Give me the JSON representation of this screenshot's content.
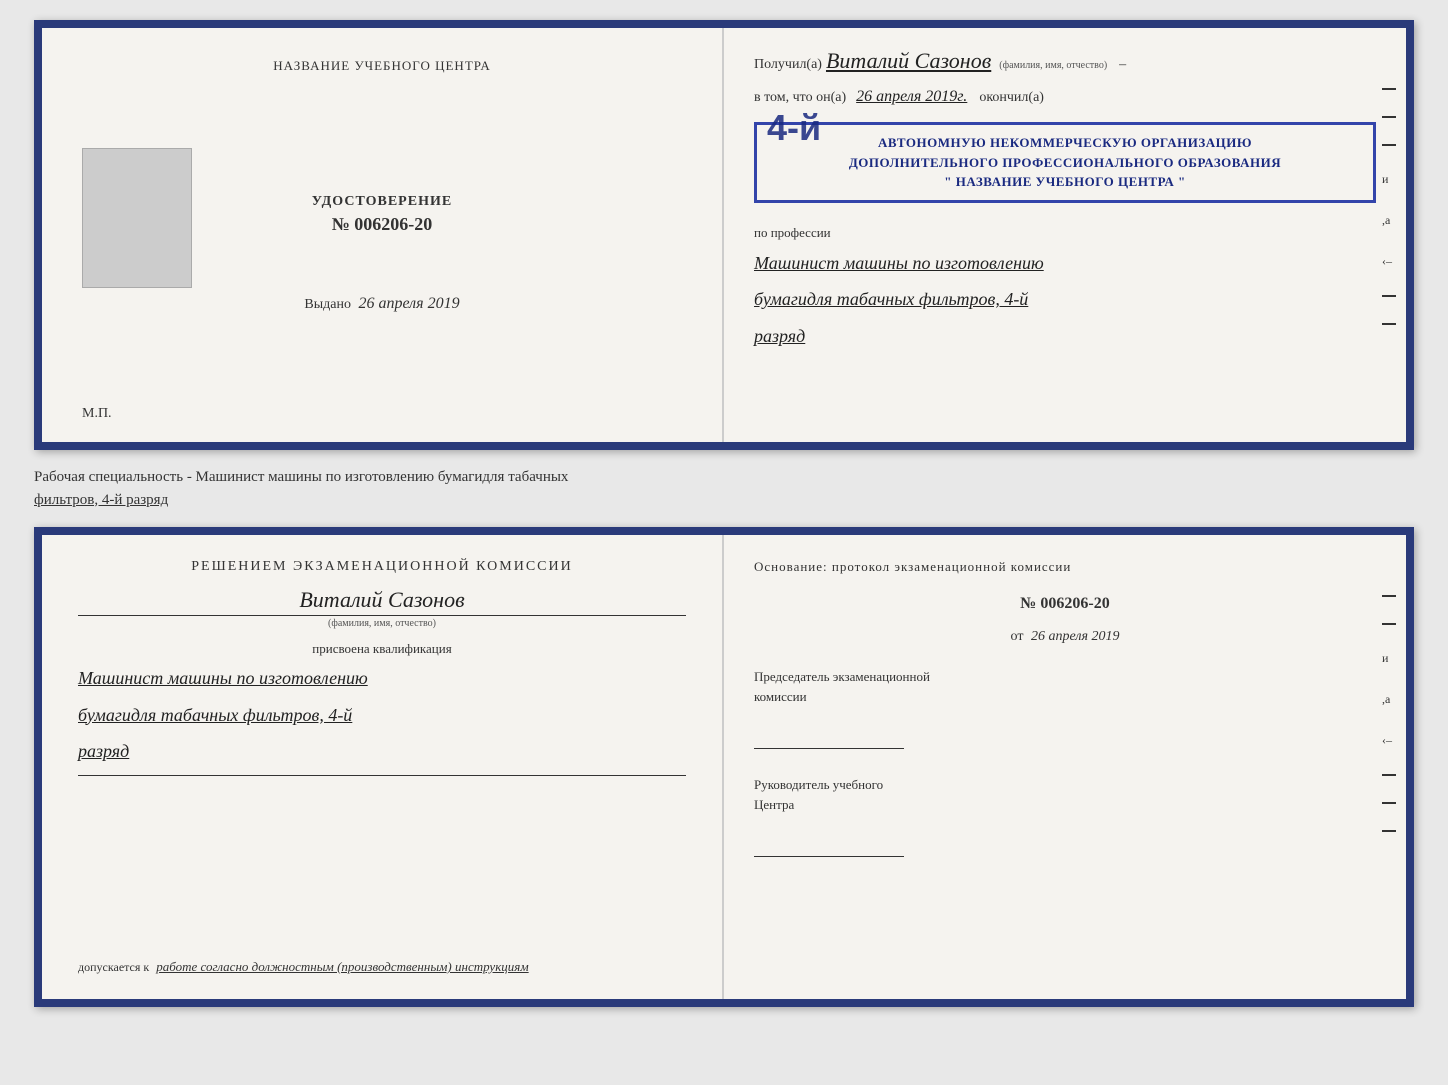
{
  "top_doc": {
    "left": {
      "center_title": "НАЗВАНИЕ УЧЕБНОГО ЦЕНТРА",
      "photo_alt": "photo placeholder",
      "udostoverenie_label": "УДОСТОВЕРЕНИЕ",
      "udostoverenie_num": "№ 006206-20",
      "vydano_label": "Выдано",
      "vydano_date": "26 апреля 2019",
      "mp_label": "М.П."
    },
    "right": {
      "poluchil_prefix": "Получил(а)",
      "name_handwritten": "Виталий Сазонов",
      "fio_small": "(фамилия, имя, отчество)",
      "vtom_prefix": "в том, что он(а)",
      "date_handwritten": "26 апреля 2019г.",
      "okonchil": "окончил(а)",
      "stamp_line1": "АВТОНОМНУЮ НЕКОММЕРЧЕСКУЮ ОРГАНИЗАЦИЮ",
      "stamp_line2": "ДОПОЛНИТЕЛЬНОГО ПРОФЕССИОНАЛЬНОГО ОБРАЗОВАНИЯ",
      "stamp_line3": "\" НАЗВАНИЕ УЧЕБНОГО ЦЕНТРА \"",
      "stamp_number": "4-й",
      "po_professii": "по профессии",
      "prof_line1": "Машинист машины по изготовлению",
      "prof_line2": "бумагидля табачных фильтров, 4-й",
      "prof_line3": "разряд"
    }
  },
  "section_label": {
    "line1": "Рабочая специальность - Машинист машины по изготовлению бумагидля табачных",
    "line2": "фильтров, 4-й разряд"
  },
  "bottom_doc": {
    "left": {
      "resheniem_title": "Решением  экзаменационной  комиссии",
      "name_handwritten": "Виталий Сазонов",
      "fio_small": "(фамилия, имя, отчество)",
      "prisvoena_label": "присвоена квалификация",
      "qual_line1": "Машинист машины по изготовлению",
      "qual_line2": "бумагидля табачных фильтров, 4-й",
      "qual_line3": "разряд",
      "dopuskaetsya_prefix": "допускается к",
      "dopuskaetsya_text": "работе согласно должностным (производственным) инструкциям"
    },
    "right": {
      "osnovanie_title": "Основание: протокол экзаменационной  комиссии",
      "proto_num": "№  006206-20",
      "ot_label": "от",
      "ot_date": "26 апреля 2019",
      "predsedatel_label": "Председатель экзаменационной\nкомиссии",
      "rukovoditel_label": "Руководитель учебного\nЦентра"
    }
  },
  "side_dashes": [
    "–",
    "–",
    "–",
    "и",
    ",а",
    "‹–",
    "–",
    "–",
    "–"
  ],
  "side_dashes2": [
    "–",
    "–",
    "и",
    ",а",
    "‹–",
    "–",
    "–",
    "–"
  ]
}
